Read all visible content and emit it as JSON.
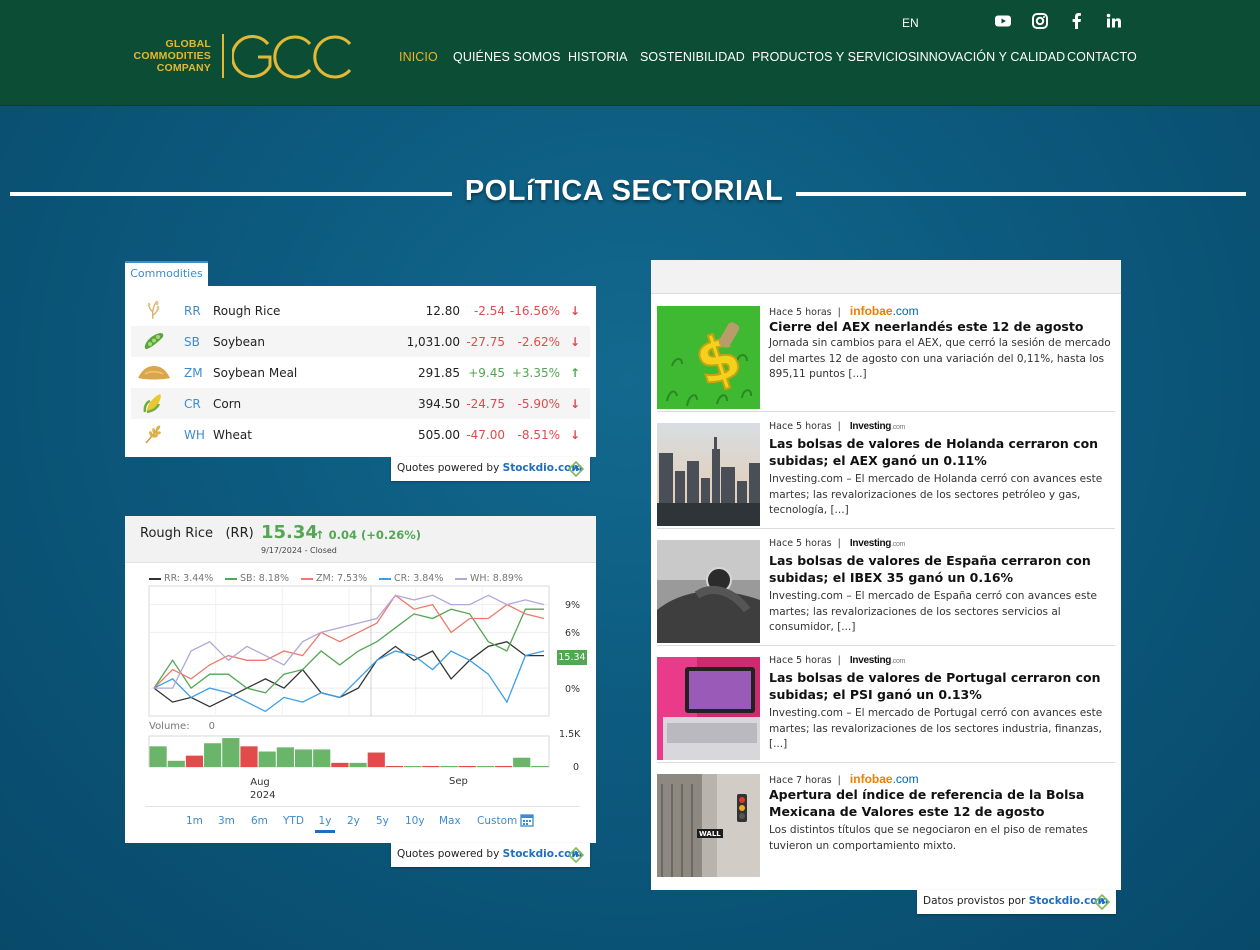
{
  "header": {
    "logo_text": [
      "GLOBAL",
      "COMMODITIES",
      "COMPANY"
    ],
    "logo_mark": "GCC",
    "lang": "EN",
    "social": [
      "youtube-icon",
      "instagram-icon",
      "facebook-icon",
      "linkedin-icon"
    ],
    "nav": [
      {
        "label": "INICIO",
        "active": true
      },
      {
        "label": "QUIÉNES SOMOS",
        "active": false
      },
      {
        "label": "HISTORIA",
        "active": false
      },
      {
        "label": "SOSTENIBILIDAD",
        "active": false
      },
      {
        "label": "PRODUCTOS Y SERVICIOS",
        "active": false
      },
      {
        "label": "INNOVACIÓN Y CALIDAD",
        "active": false
      },
      {
        "label": "CONTACTO",
        "active": false
      }
    ],
    "colors": {
      "bar": "#0b4d35",
      "accent": "#eab526"
    }
  },
  "section_title": "POLíTICA SECTORIAL",
  "commodities": {
    "tab": "Commodities",
    "rows": [
      {
        "icon": "rice-icon",
        "symbol": "RR",
        "name": "Rough Rice",
        "price": "12.80",
        "change": "-2.54",
        "pct": "-16.56%",
        "dir": "down"
      },
      {
        "icon": "soybean-icon",
        "symbol": "SB",
        "name": "Soybean",
        "price": "1,031.00",
        "change": "-27.75",
        "pct": "-2.62%",
        "dir": "down"
      },
      {
        "icon": "soybean-meal-icon",
        "symbol": "ZM",
        "name": "Soybean Meal",
        "price": "291.85",
        "change": "+9.45",
        "pct": "+3.35%",
        "dir": "up"
      },
      {
        "icon": "corn-icon",
        "symbol": "CR",
        "name": "Corn",
        "price": "394.50",
        "change": "-24.75",
        "pct": "-5.90%",
        "dir": "down"
      },
      {
        "icon": "wheat-icon",
        "symbol": "WH",
        "name": "Wheat",
        "price": "505.00",
        "change": "-47.00",
        "pct": "-8.51%",
        "dir": "down"
      }
    ],
    "powered_prefix": "Quotes powered by",
    "powered_brand": "Stockdio.com"
  },
  "chart_header": {
    "title": "Rough Rice",
    "symbol": "(RR)",
    "price": "15.34",
    "change": "↑ 0.04  (+0.26%)",
    "date": "9/17/2024  -  Closed"
  },
  "chart_data": {
    "type": "line",
    "series": [
      {
        "name": "RR",
        "last": "3.44%",
        "color": "#333333",
        "values": [
          0,
          -1.5,
          -1,
          -2,
          -1,
          0,
          1,
          0,
          2,
          -0.5,
          -1,
          0,
          3,
          4.5,
          3,
          4,
          1,
          3,
          4.5,
          5,
          3.5,
          3.5
        ]
      },
      {
        "name": "SB",
        "last": "8.18%",
        "color": "#53a653",
        "values": [
          0,
          3,
          0,
          1.5,
          1.5,
          0,
          -0.5,
          1.5,
          2,
          4,
          2.5,
          4,
          5,
          6.5,
          8,
          7.5,
          8.5,
          8,
          5,
          4,
          8.5,
          8.5
        ]
      },
      {
        "name": "ZM",
        "last": "7.53%",
        "color": "#ee7a6b",
        "values": [
          0,
          2,
          1,
          2.5,
          3.5,
          3,
          3,
          4,
          3.5,
          6,
          5,
          6,
          7,
          10,
          8.5,
          9,
          6,
          7.5,
          7.5,
          9,
          8,
          7.5
        ]
      },
      {
        "name": "CR",
        "last": "3.84%",
        "color": "#3c9ee6",
        "values": [
          0,
          1,
          -1,
          0,
          -0.5,
          -1.5,
          -2.5,
          -1,
          -1.5,
          -0.5,
          -1,
          1,
          3,
          4,
          3.5,
          2,
          4,
          3,
          1.5,
          -1.5,
          3.5,
          4
        ]
      },
      {
        "name": "WH",
        "last": "8.89%",
        "color": "#b3a6d8",
        "values": [
          0,
          0,
          4,
          5,
          3,
          4.5,
          3.5,
          2.5,
          5,
          6,
          6.5,
          7,
          7.5,
          10,
          9.5,
          10,
          9,
          9,
          10,
          9,
          9.5,
          9
        ]
      }
    ],
    "y_ticks": [
      "9%",
      "6%",
      "0%"
    ],
    "y_values": [
      9,
      6,
      0
    ],
    "ylim": [
      -3,
      11
    ],
    "price_tag": "15.34",
    "volume_label": "Volume:",
    "volume_value": "0",
    "volume_ticks": [
      "1.5K",
      "0"
    ],
    "volume": [
      {
        "v": 1.0,
        "c": "#6bb56b"
      },
      {
        "v": 0.3,
        "c": "#6bb56b"
      },
      {
        "v": 0.55,
        "c": "#e14b4b"
      },
      {
        "v": 1.15,
        "c": "#6bb56b"
      },
      {
        "v": 1.4,
        "c": "#6bb56b"
      },
      {
        "v": 1.0,
        "c": "#e14b4b"
      },
      {
        "v": 0.75,
        "c": "#6bb56b"
      },
      {
        "v": 0.95,
        "c": "#6bb56b"
      },
      {
        "v": 0.85,
        "c": "#6bb56b"
      },
      {
        "v": 0.85,
        "c": "#6bb56b"
      },
      {
        "v": 0.2,
        "c": "#e14b4b"
      },
      {
        "v": 0.2,
        "c": "#6bb56b"
      },
      {
        "v": 0.7,
        "c": "#e14b4b"
      },
      {
        "v": 0.05,
        "c": "#e14b4b"
      },
      {
        "v": 0.05,
        "c": "#6bb56b"
      },
      {
        "v": 0.05,
        "c": "#e14b4b"
      },
      {
        "v": 0.05,
        "c": "#6bb56b"
      },
      {
        "v": 0.05,
        "c": "#e14b4b"
      },
      {
        "v": 0.05,
        "c": "#6bb56b"
      },
      {
        "v": 0.05,
        "c": "#e14b4b"
      },
      {
        "v": 0.45,
        "c": "#6bb56b"
      },
      {
        "v": 0.05,
        "c": "#6bb56b"
      }
    ],
    "x_labels": [
      {
        "label": "Aug",
        "sub": "2024"
      },
      {
        "label": "Sep",
        "sub": ""
      }
    ],
    "grid": true
  },
  "ranges": [
    {
      "label": "1m",
      "selected": false
    },
    {
      "label": "3m",
      "selected": false
    },
    {
      "label": "6m",
      "selected": false
    },
    {
      "label": "YTD",
      "selected": false
    },
    {
      "label": "1y",
      "selected": true
    },
    {
      "label": "2y",
      "selected": false
    },
    {
      "label": "5y",
      "selected": false
    },
    {
      "label": "10y",
      "selected": false
    },
    {
      "label": "Max",
      "selected": false
    },
    {
      "label": "Custom",
      "selected": false
    }
  ],
  "chart_powered": {
    "prefix": "Quotes powered by",
    "brand": "Stockdio.com"
  },
  "news": {
    "items": [
      {
        "time": "Hace 5 horas",
        "source": "infobae",
        "source_suffix": ".com",
        "title": "Cierre del AEX neerlandés este 12 de agosto",
        "desc": "Jornada sin cambios para el AEX, que cerró la sesión de mercado del martes 12 de agosto con una variación del 0,11%, hasta los 895,11 puntos [...]",
        "thumb": "dollar-sign"
      },
      {
        "time": "Hace 5 horas",
        "source": "Investing",
        "source_suffix": ".com",
        "title": "Las bolsas de valores de Holanda cerraron con subidas; el AEX ganó un 0.11%",
        "desc": "Investing.com – El mercado de Holanda cerró con avances este martes; las revalorizaciones de los sectores petróleo y gas, tecnología, [...]",
        "thumb": "city"
      },
      {
        "time": "Hace 5 horas",
        "source": "Investing",
        "source_suffix": ".com",
        "title": "Las bolsas de valores de España cerraron con subidas; el IBEX 35 ganó un 0.16%",
        "desc": "Investing.com – El mercado de España cerró con avances este martes; las revalorizaciones de los sectores servicios al consumidor, [...]",
        "thumb": "watch"
      },
      {
        "time": "Hace 5 horas",
        "source": "Investing",
        "source_suffix": ".com",
        "title": "Las bolsas de valores de Portugal cerraron con subidas; el PSI ganó un 0.13%",
        "desc": "Investing.com – El mercado de Portugal cerró con avances este martes; las revalorizaciones de los sectores industria, finanzas, [...]",
        "thumb": "laptop"
      },
      {
        "time": "Hace 7 horas",
        "source": "infobae",
        "source_suffix": ".com",
        "title": "Apertura del índice de referencia de la Bolsa Mexicana de Valores este 12 de agosto",
        "desc": "Los distintos títulos que se negociaron en el piso de remates tuvieron un comportamiento mixto.",
        "thumb": "wall-street"
      }
    ],
    "powered_prefix": "Datos provistos por",
    "powered_brand": "Stockdio.com"
  }
}
